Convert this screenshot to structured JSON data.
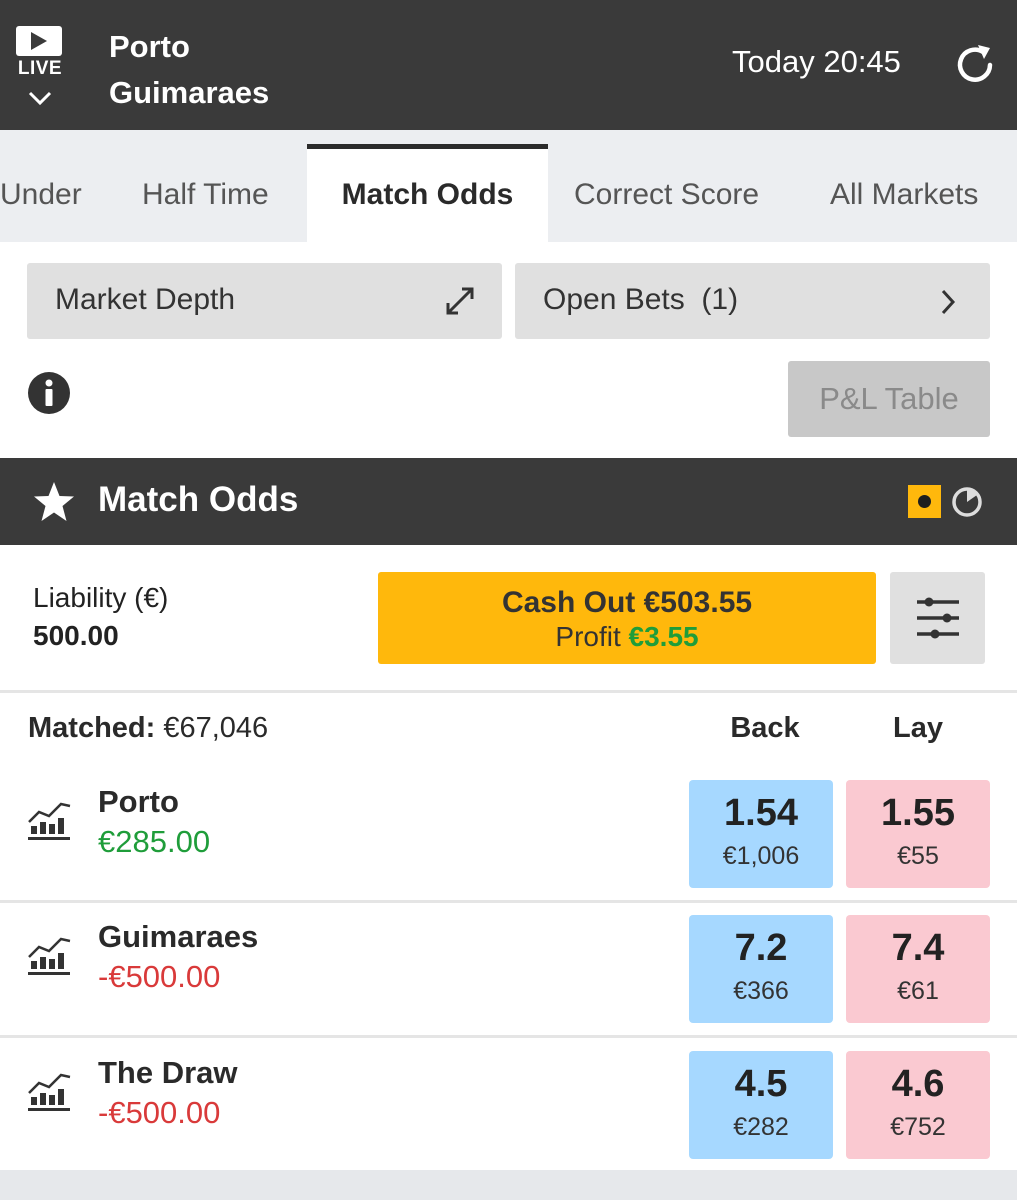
{
  "header": {
    "live_label": "LIVE",
    "home_team": "Porto",
    "away_team": "Guimaraes",
    "time": "Today 20:45",
    "icons": {
      "live": "play-icon",
      "collapse": "chevron-down-icon",
      "refresh": "refresh-icon"
    }
  },
  "tabs": [
    {
      "label": "Under"
    },
    {
      "label": "Half Time"
    },
    {
      "label": "Match Odds",
      "active": true
    },
    {
      "label": "Correct Score"
    },
    {
      "label": "All Markets"
    }
  ],
  "actions": {
    "market_depth": "Market Depth",
    "open_bets": "Open Bets  (1)",
    "pl_table": "P&L Table"
  },
  "market": {
    "title": "Match Odds",
    "liability_label": "Liability (€)",
    "liability_value": "500.00",
    "cashout_label": "Cash Out €503.55",
    "profit_label": "Profit",
    "profit_value": "€3.55",
    "matched_label": "Matched:",
    "matched_value": "€67,046",
    "back_label": "Back",
    "lay_label": "Lay",
    "runners": [
      {
        "name": "Porto",
        "pl": "€285.00",
        "back_price": "1.54",
        "back_vol": "€1,006",
        "lay_price": "1.55",
        "lay_vol": "€55"
      },
      {
        "name": "Guimaraes",
        "pl": "-€500.00",
        "back_price": "7.2",
        "back_vol": "€366",
        "lay_price": "7.4",
        "lay_vol": "€61"
      },
      {
        "name": "The Draw",
        "pl": "-€500.00",
        "back_price": "4.5",
        "back_vol": "€282",
        "lay_price": "4.6",
        "lay_vol": "€752"
      }
    ]
  },
  "colors": {
    "header_bg": "#3a3a3a",
    "accent_yellow": "#ffb80c",
    "back_blue": "#a6d8ff",
    "lay_pink": "#fac9d1",
    "profit_green": "#1f9d3a",
    "loss_red": "#d93a3a"
  }
}
